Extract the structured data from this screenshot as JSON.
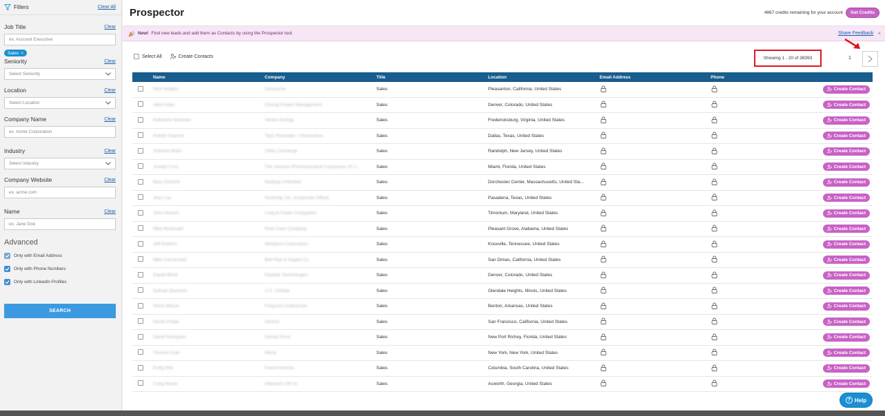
{
  "sidebar": {
    "title": "Filters",
    "clear_all": "Clear All",
    "clear": "Clear",
    "job_title": {
      "label": "Job Title",
      "placeholder": "ex. Account Executive",
      "tag": "Sales"
    },
    "seniority": {
      "label": "Seniority",
      "value": "Select Seniority"
    },
    "location": {
      "label": "Location",
      "value": "Select Location"
    },
    "company_name": {
      "label": "Company Name",
      "placeholder": "ex. Acme Corporation"
    },
    "industry": {
      "label": "Industry",
      "value": "Select Industry"
    },
    "company_website": {
      "label": "Company Website",
      "placeholder": "ex. acme.com"
    },
    "name": {
      "label": "Name",
      "placeholder": "ex. Jane Doe"
    },
    "advanced": {
      "title": "Advanced",
      "options": [
        {
          "label": "Only with Email Address",
          "checked": false
        },
        {
          "label": "Only with Phone Numbers",
          "checked": true
        },
        {
          "label": "Only with LinkedIn Profiles",
          "checked": true
        }
      ]
    },
    "search_label": "SEARCH"
  },
  "header": {
    "title": "Prospector",
    "credits_text": "4867 credits remaining for your account",
    "get_credits": "Get Credits"
  },
  "banner": {
    "new_label": "New!",
    "message": "Find new leads and add them as Contacts by using the Prospector tool.",
    "feedback": "Share Feedback",
    "close": "×"
  },
  "toolbar": {
    "select_all": "Select All",
    "create_contacts": "Create Contacts",
    "showing": "Showing 1 - 20 of 38393",
    "page": "1"
  },
  "table": {
    "columns": [
      "Name",
      "Company",
      "Title",
      "Location",
      "Email Address",
      "Phone"
    ],
    "action_label": "Create Contact",
    "rows": [
      {
        "name": "Nick Hodges",
        "company": "Gainsense",
        "title": "Sales",
        "location": "Pleasanton, California, United States"
      },
      {
        "name": "Jake Hope",
        "company": "Clickup Project Management",
        "title": "Sales",
        "location": "Denver, Colorado, United States"
      },
      {
        "name": "Katherine Newman",
        "company": "Ventus Energy",
        "title": "Sales",
        "location": "Fredericksburg, Virginia, United States"
      },
      {
        "name": "Patrick Sharma",
        "company": "Top1 Workwide + Restoration",
        "title": "Sales",
        "location": "Dallas, Texas, United States"
      },
      {
        "name": "Anthony Mann",
        "company": "Utility Concierge",
        "title": "Sales",
        "location": "Randolph, New Jersey, United States"
      },
      {
        "name": "Joseph Cruz",
        "company": "The Janssen Pharmaceutical Companies Of J...",
        "title": "Sales",
        "location": "Miami, Florida, United States"
      },
      {
        "name": "Mary Dummit",
        "company": "Mailings Unlimited",
        "title": "Sales",
        "location": "Dorchester Center, Massachusetts, United Sta..."
      },
      {
        "name": "Jean Lau",
        "company": "Sovereig, Inc. (Corporate Office)",
        "title": "Sales",
        "location": "Pasadena, Texas, United States"
      },
      {
        "name": "John Hocken",
        "company": "Long & Foster Companies",
        "title": "Sales",
        "location": "Timonium, Maryland, United States"
      },
      {
        "name": "Mike Mcdonald",
        "company": "Rock Farm Company",
        "title": "Sales",
        "location": "Pleasant Grove, Alabama, United States"
      },
      {
        "name": "Jeff Roberts",
        "company": "Whirlpool Corporation",
        "title": "Sales",
        "location": "Knoxville, Tennessee, United States"
      },
      {
        "name": "Mike Carmichael",
        "company": "Bell Pipe & Supply Co.",
        "title": "Sales",
        "location": "San Dimas, California, United States"
      },
      {
        "name": "Daniel Mindl",
        "company": "Pastelle Technologies",
        "title": "Sales",
        "location": "Denver, Colorado, United States"
      },
      {
        "name": "Salman Basheeri",
        "company": "U.S. Cellular",
        "title": "Sales",
        "location": "Glendale Heights, Illinois, United States"
      },
      {
        "name": "Steve Wilson",
        "company": "Ferguson Enterprises",
        "title": "Sales",
        "location": "Benton, Arkansas, United States"
      },
      {
        "name": "Nicole Pollak",
        "company": "Verizon",
        "title": "Sales",
        "location": "San Francisco, California, United States"
      },
      {
        "name": "David Rodriguez",
        "company": "Disney Store",
        "title": "Sales",
        "location": "New Port Richey, Florida, United States"
      },
      {
        "name": "Thomas Cole",
        "company": "Blend",
        "title": "Sales",
        "location": "New York, New York, United States"
      },
      {
        "name": "Emily Ellis",
        "company": "Frand America",
        "title": "Sales",
        "location": "Columbia, South Carolina, United States"
      },
      {
        "name": "Craig Moore",
        "company": "Walmarts Off Inc.",
        "title": "Sales",
        "location": "Acworth, Georgia, United States"
      }
    ]
  },
  "help_label": "Help",
  "colors": {
    "accent": "#c862c5",
    "header": "#175d8e",
    "primary": "#1a8fd1",
    "highlight": "#e0141e"
  }
}
